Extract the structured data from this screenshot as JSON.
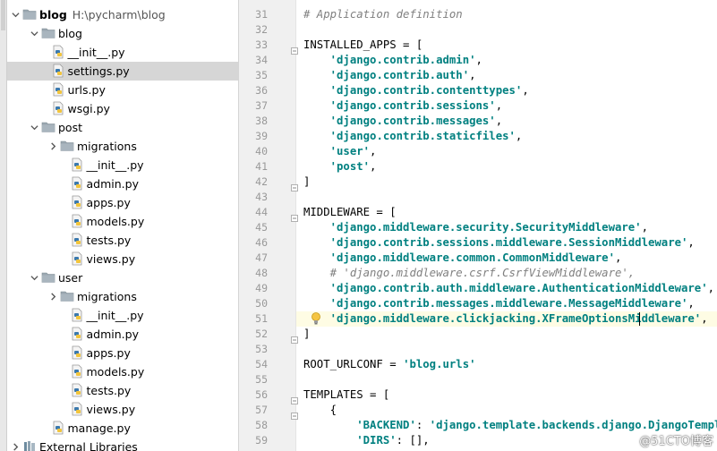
{
  "project": {
    "root": {
      "name": "blog",
      "path": "H:\\pycharm\\blog"
    },
    "items": [
      {
        "label": "blog",
        "type": "folder",
        "expanded": true
      },
      {
        "label": "__init__.py",
        "type": "py"
      },
      {
        "label": "settings.py",
        "type": "py",
        "selected": true
      },
      {
        "label": "urls.py",
        "type": "py"
      },
      {
        "label": "wsgi.py",
        "type": "py"
      },
      {
        "label": "post",
        "type": "folder",
        "expanded": true
      },
      {
        "label": "migrations",
        "type": "folder",
        "expanded": false
      },
      {
        "label": "__init__.py",
        "type": "py"
      },
      {
        "label": "admin.py",
        "type": "py"
      },
      {
        "label": "apps.py",
        "type": "py"
      },
      {
        "label": "models.py",
        "type": "py"
      },
      {
        "label": "tests.py",
        "type": "py"
      },
      {
        "label": "views.py",
        "type": "py"
      },
      {
        "label": "user",
        "type": "folder",
        "expanded": true
      },
      {
        "label": "migrations",
        "type": "folder",
        "expanded": false
      },
      {
        "label": "__init__.py",
        "type": "py"
      },
      {
        "label": "admin.py",
        "type": "py"
      },
      {
        "label": "apps.py",
        "type": "py"
      },
      {
        "label": "models.py",
        "type": "py"
      },
      {
        "label": "tests.py",
        "type": "py"
      },
      {
        "label": "views.py",
        "type": "py"
      },
      {
        "label": "manage.py",
        "type": "py"
      },
      {
        "label": "External Libraries",
        "type": "lib",
        "expanded": false
      }
    ]
  },
  "editor": {
    "current_line": 51,
    "lines": [
      {
        "n": "31",
        "code": [
          [
            "cm",
            "# Application definition"
          ]
        ]
      },
      {
        "n": "32",
        "code": []
      },
      {
        "n": "33",
        "code": [
          [
            "kw",
            "INSTALLED_APPS = ["
          ]
        ]
      },
      {
        "n": "34",
        "code": [
          [
            "kw",
            "    "
          ],
          [
            "str",
            "'django.contrib.admin'"
          ],
          [
            "kw",
            ","
          ]
        ]
      },
      {
        "n": "35",
        "code": [
          [
            "kw",
            "    "
          ],
          [
            "str",
            "'django.contrib.auth'"
          ],
          [
            "kw",
            ","
          ]
        ]
      },
      {
        "n": "36",
        "code": [
          [
            "kw",
            "    "
          ],
          [
            "str",
            "'django.contrib.contenttypes'"
          ],
          [
            "kw",
            ","
          ]
        ]
      },
      {
        "n": "37",
        "code": [
          [
            "kw",
            "    "
          ],
          [
            "str",
            "'django.contrib.sessions'"
          ],
          [
            "kw",
            ","
          ]
        ]
      },
      {
        "n": "38",
        "code": [
          [
            "kw",
            "    "
          ],
          [
            "str",
            "'django.contrib.messages'"
          ],
          [
            "kw",
            ","
          ]
        ]
      },
      {
        "n": "39",
        "code": [
          [
            "kw",
            "    "
          ],
          [
            "str",
            "'django.contrib.staticfiles'"
          ],
          [
            "kw",
            ","
          ]
        ]
      },
      {
        "n": "40",
        "code": [
          [
            "kw",
            "    "
          ],
          [
            "str",
            "'user'"
          ],
          [
            "kw",
            ","
          ]
        ]
      },
      {
        "n": "41",
        "code": [
          [
            "kw",
            "    "
          ],
          [
            "str",
            "'post'"
          ],
          [
            "kw",
            ","
          ]
        ]
      },
      {
        "n": "42",
        "code": [
          [
            "kw",
            "]"
          ]
        ]
      },
      {
        "n": "43",
        "code": []
      },
      {
        "n": "44",
        "code": [
          [
            "kw",
            "MIDDLEWARE = ["
          ]
        ]
      },
      {
        "n": "45",
        "code": [
          [
            "kw",
            "    "
          ],
          [
            "str",
            "'django.middleware.security.SecurityMiddleware'"
          ],
          [
            "kw",
            ","
          ]
        ]
      },
      {
        "n": "46",
        "code": [
          [
            "kw",
            "    "
          ],
          [
            "str",
            "'django.contrib.sessions.middleware.SessionMiddleware'"
          ],
          [
            "kw",
            ","
          ]
        ]
      },
      {
        "n": "47",
        "code": [
          [
            "kw",
            "    "
          ],
          [
            "str",
            "'django.middleware.common.CommonMiddleware'"
          ],
          [
            "kw",
            ","
          ]
        ]
      },
      {
        "n": "48",
        "code": [
          [
            "kw",
            "    "
          ],
          [
            "cm",
            "# 'django.middleware.csrf.CsrfViewMiddleware',"
          ]
        ]
      },
      {
        "n": "49",
        "code": [
          [
            "kw",
            "    "
          ],
          [
            "str",
            "'django.contrib.auth.middleware.AuthenticationMiddleware'"
          ],
          [
            "kw",
            ","
          ]
        ]
      },
      {
        "n": "50",
        "code": [
          [
            "kw",
            "    "
          ],
          [
            "str",
            "'django.contrib.messages.middleware.MessageMiddleware'"
          ],
          [
            "kw",
            ","
          ]
        ]
      },
      {
        "n": "51",
        "code": [
          [
            "kw",
            "    "
          ],
          [
            "str",
            "'django.middleware.clickjacking.XFrameOptionsMiddleware'"
          ],
          [
            "kw",
            ","
          ]
        ]
      },
      {
        "n": "52",
        "code": [
          [
            "kw",
            "]"
          ]
        ]
      },
      {
        "n": "53",
        "code": []
      },
      {
        "n": "54",
        "code": [
          [
            "kw",
            "ROOT_URLCONF = "
          ],
          [
            "str",
            "'blog.urls'"
          ]
        ]
      },
      {
        "n": "55",
        "code": []
      },
      {
        "n": "56",
        "code": [
          [
            "kw",
            "TEMPLATES = ["
          ]
        ]
      },
      {
        "n": "57",
        "code": [
          [
            "kw",
            "    {"
          ]
        ]
      },
      {
        "n": "58",
        "code": [
          [
            "kw",
            "        "
          ],
          [
            "str",
            "'BACKEND'"
          ],
          [
            "kw",
            ": "
          ],
          [
            "str",
            "'django.template.backends.django.DjangoTemplates'"
          ],
          [
            "kw",
            ","
          ]
        ]
      },
      {
        "n": "59",
        "code": [
          [
            "kw",
            "        "
          ],
          [
            "str",
            "'DIRS'"
          ],
          [
            "kw",
            ": [],"
          ]
        ]
      }
    ]
  },
  "watermark": "@51CTO博客",
  "colors": {
    "string": "#008080",
    "comment": "#808080",
    "current_line": "#fefce4",
    "selection": "#d6d6d6"
  }
}
